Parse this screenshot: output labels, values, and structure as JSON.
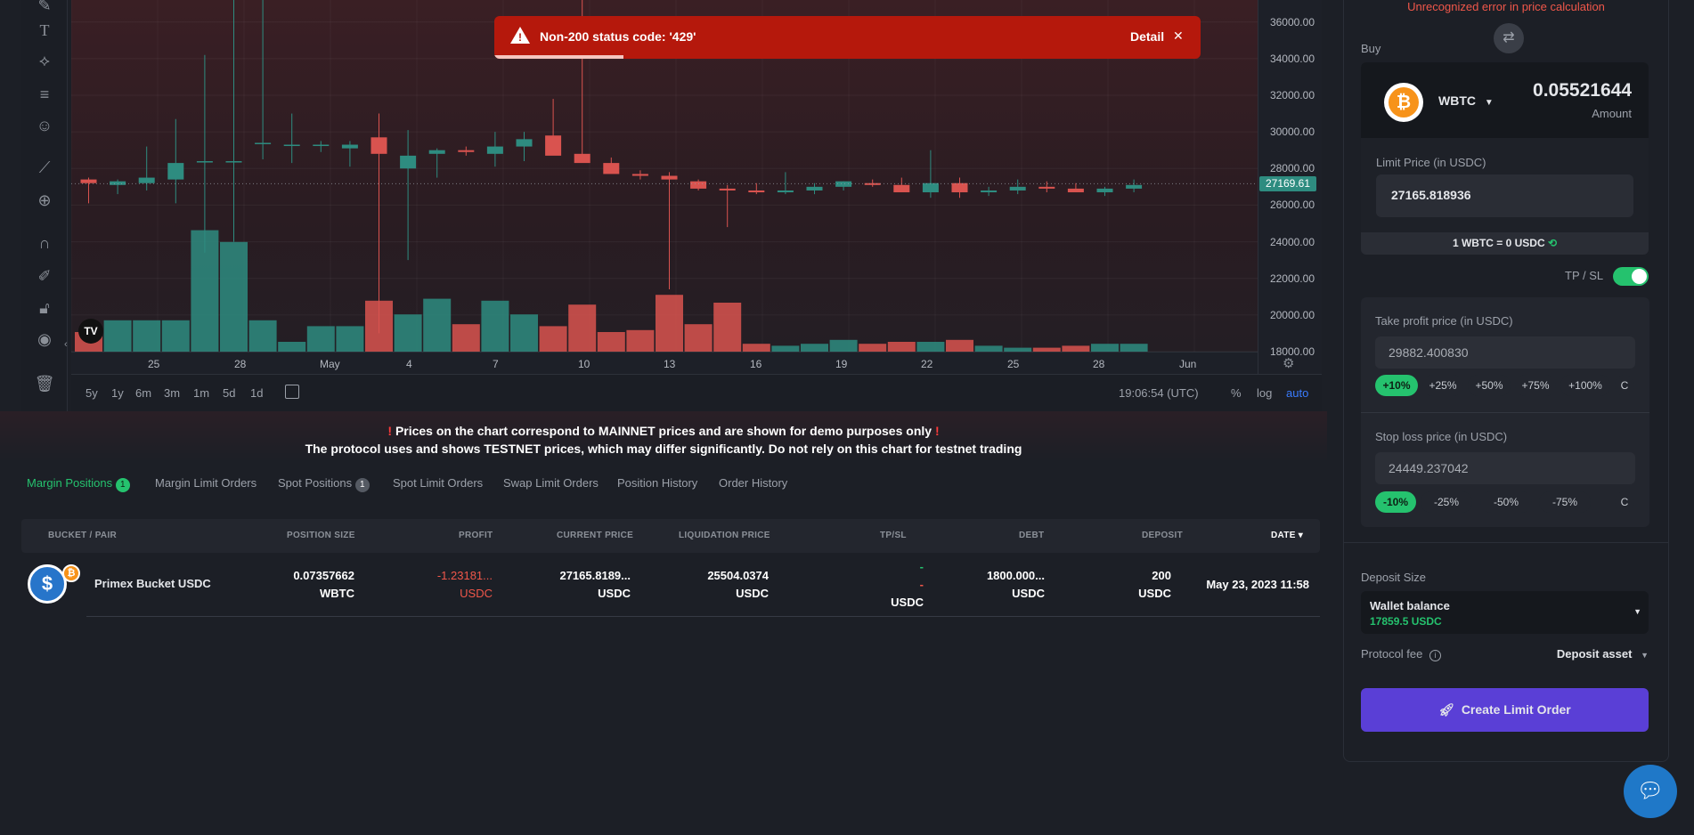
{
  "toast": {
    "message": "Non-200 status code: '429'",
    "detail_label": "Detail",
    "close_glyph": "✕",
    "color": "#b5180c"
  },
  "chart": {
    "price_ticks": [
      "36000.00",
      "34000.00",
      "32000.00",
      "30000.00",
      "28000.00",
      "26000.00",
      "24000.00",
      "22000.00",
      "20000.00",
      "18000.00"
    ],
    "current_price_label": "27169.61",
    "time_ticks": [
      "25",
      "28",
      "May",
      "4",
      "7",
      "10",
      "13",
      "16",
      "19",
      "22",
      "25",
      "28",
      "Jun"
    ],
    "ranges": [
      "5y",
      "1y",
      "6m",
      "3m",
      "1m",
      "5d",
      "1d"
    ],
    "clock": "19:06:54 (UTC)",
    "scale_opts": [
      "%",
      "log",
      "auto"
    ],
    "logo": "TV",
    "candle_colors": {
      "up": "#2e8c80",
      "down": "#d9534f"
    },
    "candles": [
      {
        "o": 27400,
        "h": 27500,
        "l": 26100,
        "c": 27200,
        "v": 1.0
      },
      {
        "o": 27100,
        "h": 27400,
        "l": 26600,
        "c": 27300,
        "v": 1.6
      },
      {
        "o": 27200,
        "h": 29200,
        "l": 26800,
        "c": 27500,
        "v": 1.6
      },
      {
        "o": 27400,
        "h": 30700,
        "l": 26100,
        "c": 28300,
        "v": 1.6
      },
      {
        "o": 28400,
        "h": 34200,
        "l": 23400,
        "c": 28400,
        "v": 6.2
      },
      {
        "o": 28400,
        "h": 38000,
        "l": 24000,
        "c": 28400,
        "v": 5.6
      },
      {
        "o": 29400,
        "h": 38000,
        "l": 28500,
        "c": 29400,
        "v": 1.6
      },
      {
        "o": 29300,
        "h": 31000,
        "l": 28300,
        "c": 29300,
        "v": 0.5
      },
      {
        "o": 29300,
        "h": 29500,
        "l": 28900,
        "c": 29300,
        "v": 1.3
      },
      {
        "o": 29100,
        "h": 29500,
        "l": 28100,
        "c": 29300,
        "v": 1.3
      },
      {
        "o": 29700,
        "h": 31000,
        "l": 19000,
        "c": 28800,
        "v": 2.6
      },
      {
        "o": 28000,
        "h": 30100,
        "l": 23000,
        "c": 28700,
        "v": 1.9
      },
      {
        "o": 28800,
        "h": 29100,
        "l": 27500,
        "c": 29000,
        "v": 2.7
      },
      {
        "o": 29000,
        "h": 29200,
        "l": 28700,
        "c": 28900,
        "v": 1.4
      },
      {
        "o": 28800,
        "h": 30000,
        "l": 28100,
        "c": 29200,
        "v": 2.6
      },
      {
        "o": 29200,
        "h": 30000,
        "l": 28400,
        "c": 29600,
        "v": 1.9
      },
      {
        "o": 29800,
        "h": 31800,
        "l": 28900,
        "c": 28700,
        "v": 1.3
      },
      {
        "o": 28800,
        "h": 38000,
        "l": 28500,
        "c": 28300,
        "v": 2.4
      },
      {
        "o": 28300,
        "h": 28600,
        "l": 28100,
        "c": 27700,
        "v": 1.0
      },
      {
        "o": 27700,
        "h": 27900,
        "l": 27400,
        "c": 27600,
        "v": 1.1
      },
      {
        "o": 27600,
        "h": 27800,
        "l": 21400,
        "c": 27400,
        "v": 2.9
      },
      {
        "o": 27300,
        "h": 27400,
        "l": 26800,
        "c": 26900,
        "v": 1.4
      },
      {
        "o": 26900,
        "h": 27100,
        "l": 24800,
        "c": 26800,
        "v": 2.5
      },
      {
        "o": 26800,
        "h": 27200,
        "l": 26600,
        "c": 26700,
        "v": 0.4
      },
      {
        "o": 26700,
        "h": 27800,
        "l": 26600,
        "c": 26800,
        "v": 0.3
      },
      {
        "o": 26800,
        "h": 27200,
        "l": 26600,
        "c": 27000,
        "v": 0.4
      },
      {
        "o": 27000,
        "h": 27300,
        "l": 26800,
        "c": 27300,
        "v": 0.6
      },
      {
        "o": 27200,
        "h": 27400,
        "l": 27000,
        "c": 27100,
        "v": 0.4
      },
      {
        "o": 27100,
        "h": 27500,
        "l": 26800,
        "c": 26700,
        "v": 0.5
      },
      {
        "o": 26700,
        "h": 29000,
        "l": 26400,
        "c": 27200,
        "v": 0.5
      },
      {
        "o": 27200,
        "h": 27500,
        "l": 26400,
        "c": 26700,
        "v": 0.6
      },
      {
        "o": 26700,
        "h": 27000,
        "l": 26500,
        "c": 26800,
        "v": 0.3
      },
      {
        "o": 26800,
        "h": 27400,
        "l": 26600,
        "c": 27000,
        "v": 0.2
      },
      {
        "o": 27000,
        "h": 27300,
        "l": 26700,
        "c": 26900,
        "v": 0.2
      },
      {
        "o": 26900,
        "h": 27200,
        "l": 26700,
        "c": 26700,
        "v": 0.3
      },
      {
        "o": 26700,
        "h": 27000,
        "l": 26500,
        "c": 26900,
        "v": 0.4
      },
      {
        "o": 26900,
        "h": 27400,
        "l": 26700,
        "c": 27100,
        "v": 0.4
      }
    ],
    "y_min": 18000,
    "y_max": 37200
  },
  "notice": {
    "line1": "Prices on the chart correspond to MAINNET prices and are shown for demo purposes only",
    "line2": "The protocol uses and shows TESTNET prices, which may differ significantly. Do not rely on this chart for testnet trading",
    "mark": "!"
  },
  "tabs": [
    {
      "label": "Margin Positions",
      "badge": "1",
      "active": true
    },
    {
      "label": "Margin Limit Orders"
    },
    {
      "label": "Spot Positions",
      "badge": "1"
    },
    {
      "label": "Spot Limit Orders"
    },
    {
      "label": "Swap Limit Orders"
    },
    {
      "label": "Position History"
    },
    {
      "label": "Order History"
    }
  ],
  "table": {
    "headers": [
      "BUCKET / PAIR",
      "POSITION SIZE",
      "PROFIT",
      "CURRENT PRICE",
      "LIQUIDATION PRICE",
      "TP/SL",
      "DEBT",
      "DEPOSIT",
      "DATE"
    ],
    "row": {
      "bucket": "Primex Bucket USDC",
      "size": "0.07357662",
      "size_unit": "WBTC",
      "profit": "-1.23181...",
      "profit_unit": "USDC",
      "current": "27165.8189...",
      "current_unit": "USDC",
      "liq": "25504.0374",
      "liq_unit": "USDC",
      "tp": "-",
      "sl": "-",
      "tpsl_unit": "USDC",
      "debt": "1800.000...",
      "debt_unit": "USDC",
      "deposit": "200",
      "deposit_unit": "USDC",
      "date": "May 23, 2023 11:58"
    }
  },
  "panel": {
    "error": "Unrecognized error in price calculation",
    "buy_label": "Buy",
    "token": "WBTC",
    "amount": "0.05521644",
    "amount_label": "Amount",
    "limit_label": "Limit Price (in USDC)",
    "limit_value": "27165.818936",
    "rate": "1 WBTC = 0 USDC",
    "tpsl_label": "TP / SL",
    "tp_label": "Take profit price (in USDC)",
    "tp_value": "29882.400830",
    "tp_chips": [
      "+10%",
      "+25%",
      "+50%",
      "+75%",
      "+100%",
      "C"
    ],
    "sl_label": "Stop loss price (in USDC)",
    "sl_value": "24449.237042",
    "sl_chips": [
      "-10%",
      "-25%",
      "-50%",
      "-75%",
      "C"
    ],
    "deposit_size_label": "Deposit Size",
    "wallet_label": "Wallet balance",
    "wallet_value": "17859.5 USDC",
    "fee_label": "Protocol fee",
    "deposit_asset": "Deposit asset",
    "cta": "Create Limit Order"
  }
}
